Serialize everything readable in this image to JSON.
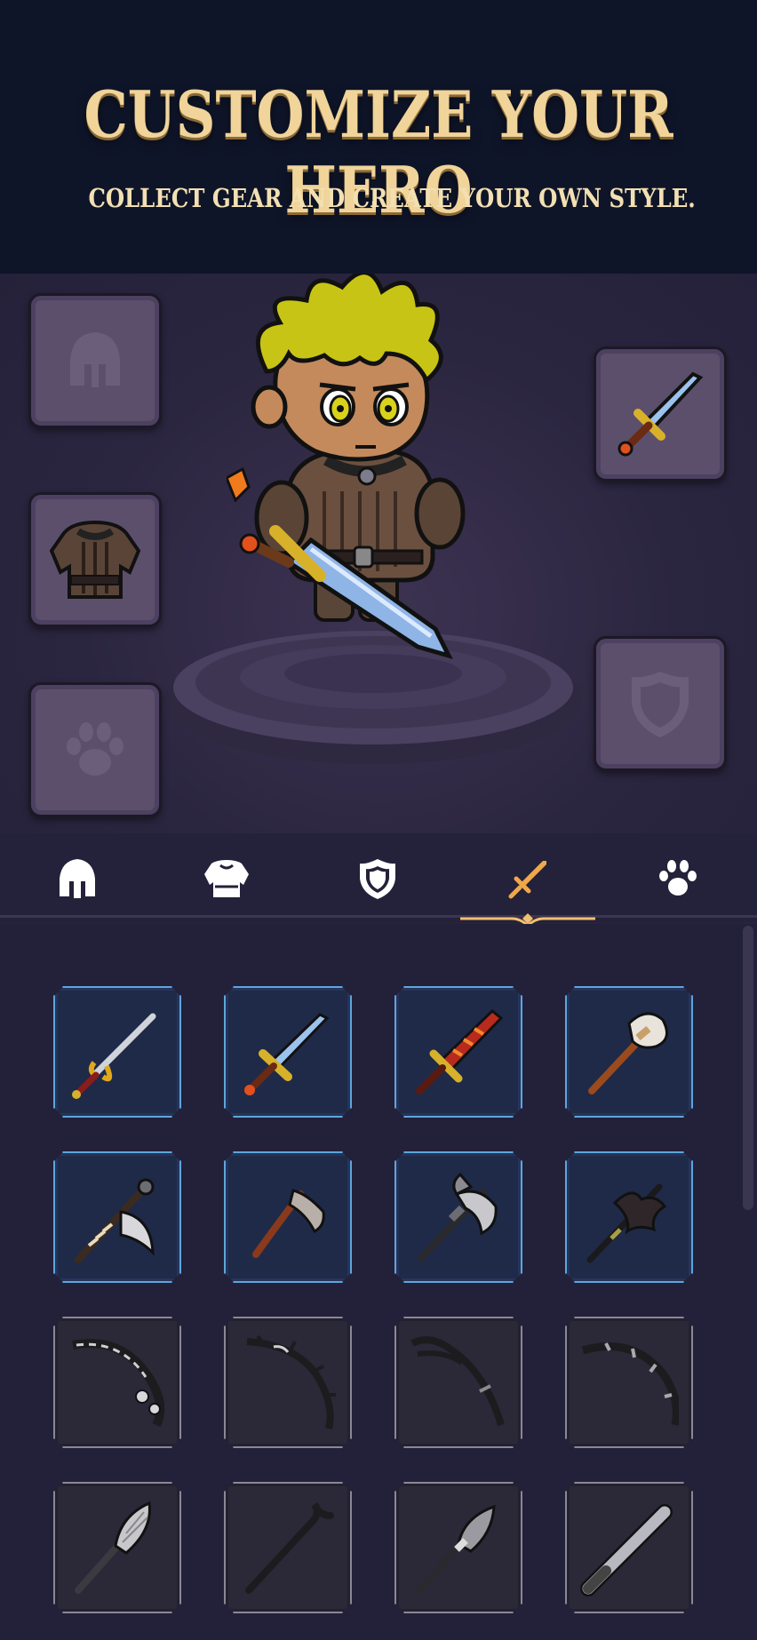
{
  "header": {
    "title": "CUSTOMIZE YOUR HERO",
    "subtitle": "COLLECT GEAR AND CREATE YOUR OWN STYLE."
  },
  "equipment_slots": [
    {
      "name": "helmet-slot",
      "icon": "helmet-icon",
      "filled": false
    },
    {
      "name": "armor-slot",
      "icon": "chest-armor",
      "filled": true
    },
    {
      "name": "pet-slot",
      "icon": "paw-icon",
      "filled": false
    },
    {
      "name": "weapon-slot",
      "icon": "crystal-sword",
      "filled": true
    },
    {
      "name": "shield-slot",
      "icon": "shield-icon",
      "filled": false
    }
  ],
  "tabs": [
    {
      "name": "helmet",
      "icon": "helmet-icon",
      "active": false
    },
    {
      "name": "armor",
      "icon": "armor-icon",
      "active": false
    },
    {
      "name": "shield",
      "icon": "shield-icon",
      "active": false
    },
    {
      "name": "weapon",
      "icon": "sword-icon",
      "active": true
    },
    {
      "name": "pet",
      "icon": "paw-icon",
      "active": false
    }
  ],
  "colors": {
    "title": "#f0d49a",
    "active_tab": "#f0a848",
    "selected_border": "#5ea6dc",
    "normal_border": "#8a8796"
  },
  "inventory": [
    {
      "item": "golden-rapier",
      "tier": "rare"
    },
    {
      "item": "crystal-sword",
      "tier": "rare"
    },
    {
      "item": "flame-sword",
      "tier": "rare"
    },
    {
      "item": "stone-hammer",
      "tier": "rare"
    },
    {
      "item": "spiked-war-axe",
      "tier": "rare"
    },
    {
      "item": "hatchet",
      "tier": "rare"
    },
    {
      "item": "double-battle-axe",
      "tier": "rare"
    },
    {
      "item": "dark-halberd",
      "tier": "rare"
    },
    {
      "item": "ornate-bow",
      "tier": "common"
    },
    {
      "item": "thorn-bow",
      "tier": "common"
    },
    {
      "item": "black-recurve-bow",
      "tier": "common"
    },
    {
      "item": "iron-bow",
      "tier": "common"
    },
    {
      "item": "broom",
      "tier": "common"
    },
    {
      "item": "crowbar",
      "tier": "common"
    },
    {
      "item": "old-broom",
      "tier": "common"
    },
    {
      "item": "baseball-bat",
      "tier": "common"
    }
  ]
}
